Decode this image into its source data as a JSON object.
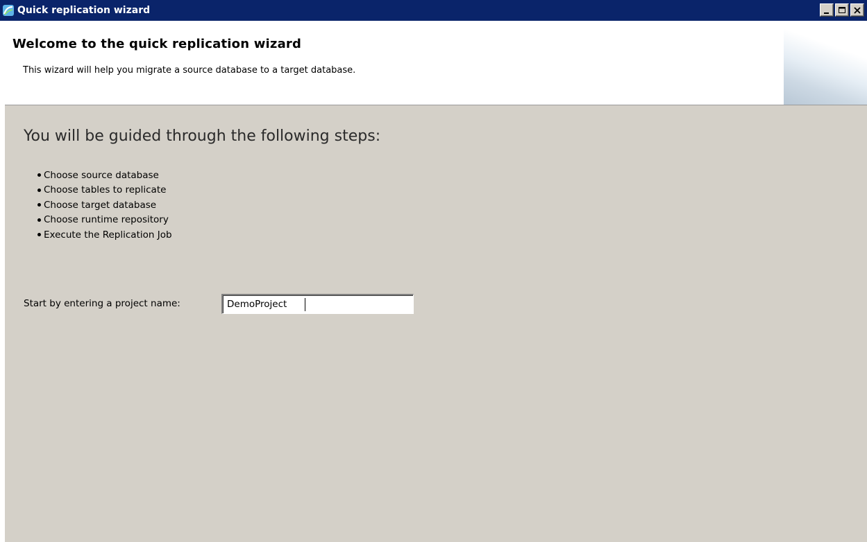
{
  "window": {
    "title": "Quick replication wizard",
    "icon": "app-icon",
    "controls": [
      "minimize",
      "maximize",
      "close"
    ]
  },
  "header": {
    "title": "Welcome to the quick replication wizard",
    "description": "This wizard will help you migrate a source database to a target database."
  },
  "main": {
    "heading": "You will be guided through the following steps:",
    "steps": [
      "Choose source database",
      "Choose tables to replicate",
      "Choose target database",
      "Choose runtime repository",
      "Execute the Replication Job"
    ],
    "project_label": "Start by entering a project name:",
    "project_value": "DemoProject"
  },
  "colors": {
    "titlebar": "#0a246a",
    "panel": "#d4d0c8",
    "header_bg": "#ffffff"
  }
}
